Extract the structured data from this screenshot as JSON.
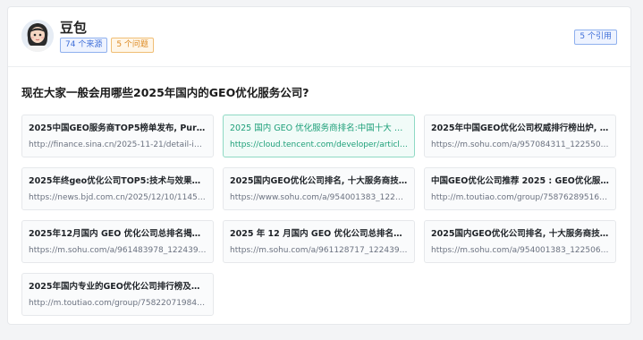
{
  "profile": {
    "name": "豆包",
    "sources_badge": "74 个来源",
    "questions_badge": "5 个问题",
    "cite_badge": "5 个引用",
    "avatar_icon": "avatar-girl-icon"
  },
  "question": "现在大家一般会用哪些2025年国内的GEO优化服务公司?",
  "sources": [
    {
      "title": "2025中国GEO服务商TOP5榜单发布, Purebl...",
      "url": "http://finance.sina.cn/2025-11-21/detail-inf..."
    },
    {
      "title": "2025 国内 GEO 优化服务商排名:中国十大 GE...",
      "url": "https://cloud.tencent.com/developer/article..."
    },
    {
      "title": "2025年中国GEO优化公司权威排行榜出炉, 百...",
      "url": "https://m.sohu.com/a/957084311_12255091..."
    },
    {
      "title": "2025年终geo优化公司TOP5:技术与效果双优...",
      "url": "https://news.bjd.com.cn/2025/12/10/11455..."
    },
    {
      "title": "2025国内GEO优化公司排名, 十大服务商技术...",
      "url": "https://www.sohu.com/a/954001383_12250..."
    },
    {
      "title": "中国GEO优化公司推荐 2025 : GEO优化服务...",
      "url": "http://m.toutiao.com/group/758762895164..."
    },
    {
      "title": "2025年12月国内 GEO 优化公司总排名揭晓, 6...",
      "url": "https://m.sohu.com/a/961483978_12243990..."
    },
    {
      "title": "2025 年 12 月国内 GEO 优化公司总排名出炉...",
      "url": "https://m.sohu.com/a/961128717_12243990..."
    },
    {
      "title": "2025国内GEO优化公司排名, 十大服务商技术...",
      "url": "https://m.sohu.com/a/954001383_12250684..."
    },
    {
      "title": "2025年国内专业的GEO优化公司排行榜及权威...",
      "url": "http://m.toutiao.com/group/758220719840..."
    }
  ],
  "active_index": 1,
  "colors": {
    "accent_blue": "#3f6fd8",
    "accent_orange": "#dd8a22",
    "accent_green": "#1fa07a"
  }
}
